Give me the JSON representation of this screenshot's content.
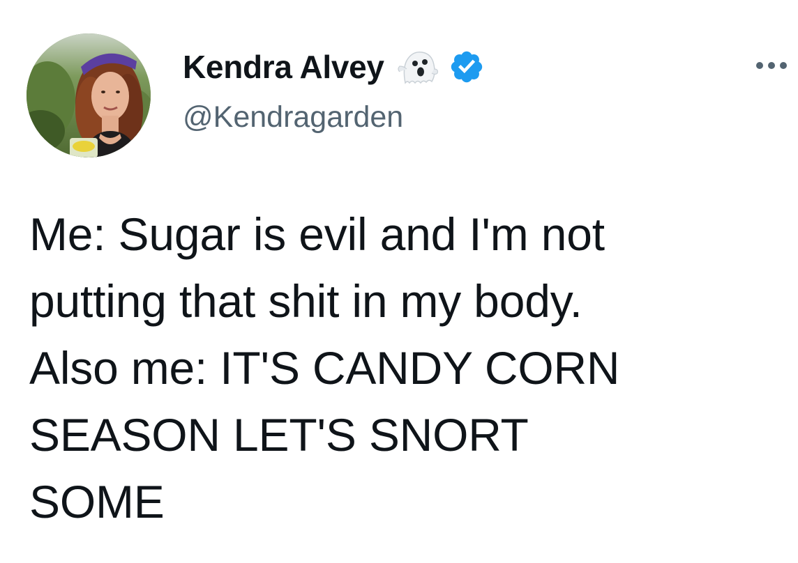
{
  "author": {
    "display_name": "Kendra Alvey",
    "handle": "@Kendragarden",
    "emoji_icon": "ghost-icon",
    "verified_icon": "verified-badge-icon",
    "verified_color": "#1d9bf0"
  },
  "tweet": {
    "text": "Me: Sugar is evil and I'm not\nputting that shit in my body.\nAlso me: IT'S CANDY CORN\nSEASON LET'S SNORT\nSOME"
  },
  "menu": {
    "icon": "more-horizontal-icon"
  },
  "colors": {
    "text_primary": "#0f1419",
    "text_secondary": "#536471",
    "background": "#ffffff"
  }
}
